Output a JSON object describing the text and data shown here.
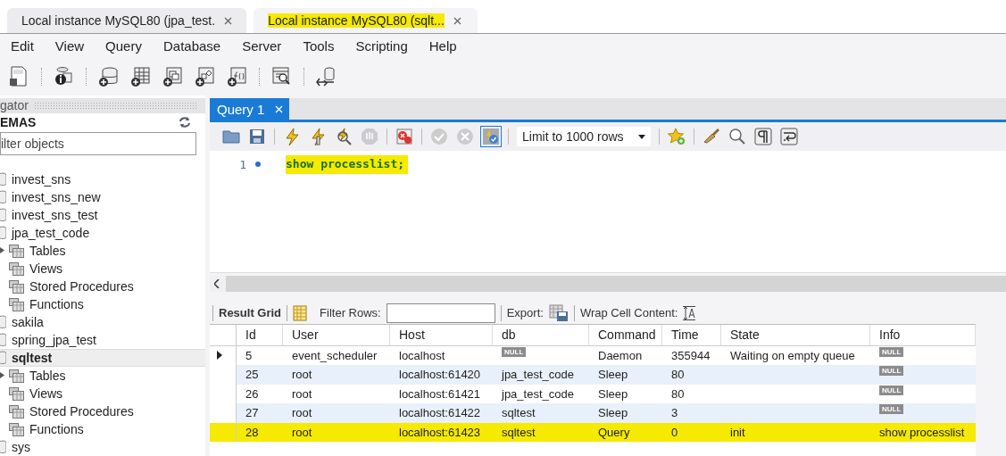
{
  "doc_tabs": [
    {
      "label": "Local instance MySQL80 (jpa_test.",
      "selected": false,
      "highlighted": false
    },
    {
      "label": "Local instance MySQL80 (sqlt...",
      "selected": true,
      "highlighted": true
    }
  ],
  "menu": [
    "Edit",
    "View",
    "Query",
    "Database",
    "Server",
    "Tools",
    "Scripting",
    "Help"
  ],
  "navigator": {
    "title": "gator",
    "schemas_label": "EMAS",
    "filter": {
      "placeholder": "ilter objects"
    },
    "schemas": [
      {
        "name": "invest_sns",
        "selected": false
      },
      {
        "name": "invest_sns_new",
        "selected": false
      },
      {
        "name": "invest_sns_test",
        "selected": false
      },
      {
        "name": "jpa_test_code",
        "selected": false,
        "children": [
          {
            "name": "Tables",
            "expander": true
          },
          {
            "name": "Views",
            "expander": false
          },
          {
            "name": "Stored Procedures",
            "expander": false
          },
          {
            "name": "Functions",
            "expander": false
          }
        ]
      },
      {
        "name": "sakila",
        "selected": false
      },
      {
        "name": "spring_jpa_test",
        "selected": false
      },
      {
        "name": "sqltest",
        "selected": true,
        "children": [
          {
            "name": "Tables",
            "expander": true
          },
          {
            "name": "Views",
            "expander": false
          },
          {
            "name": "Stored Procedures",
            "expander": false
          },
          {
            "name": "Functions",
            "expander": false
          }
        ]
      },
      {
        "name": "sys",
        "selected": false
      }
    ]
  },
  "query_tabs": [
    {
      "label": "Query 1",
      "selected": true
    }
  ],
  "editor_toolbar": {
    "limit": "Limit to 1000 rows",
    "autocommit_pressed": true
  },
  "editor": {
    "lines": [
      {
        "number": "1",
        "code": "show processlist;",
        "highlighted": true
      }
    ]
  },
  "results": {
    "tab": "Result Grid",
    "filter_label": "Filter Rows:",
    "export_label": "Export:",
    "wrap_label": "Wrap Cell Content:",
    "columns": [
      "Id",
      "User",
      "Host",
      "db",
      "Command",
      "Time",
      "State",
      "Info"
    ],
    "rows": [
      {
        "current": true,
        "highlighted": false,
        "cells": [
          {
            "kind": "value",
            "text": "5"
          },
          {
            "kind": "value",
            "text": "event_scheduler"
          },
          {
            "kind": "value",
            "text": "localhost"
          },
          {
            "kind": "null",
            "text": "NULL"
          },
          {
            "kind": "value",
            "text": "Daemon"
          },
          {
            "kind": "value",
            "text": "355944"
          },
          {
            "kind": "value",
            "text": "Waiting on empty queue"
          },
          {
            "kind": "null",
            "text": "NULL"
          }
        ]
      },
      {
        "current": false,
        "highlighted": false,
        "cells": [
          {
            "kind": "value",
            "text": "25"
          },
          {
            "kind": "value",
            "text": "root"
          },
          {
            "kind": "value",
            "text": "localhost:61420"
          },
          {
            "kind": "value",
            "text": "jpa_test_code"
          },
          {
            "kind": "value",
            "text": "Sleep"
          },
          {
            "kind": "value",
            "text": "80"
          },
          {
            "kind": "empty"
          },
          {
            "kind": "null",
            "text": "NULL"
          }
        ]
      },
      {
        "current": false,
        "highlighted": false,
        "cells": [
          {
            "kind": "value",
            "text": "26"
          },
          {
            "kind": "value",
            "text": "root"
          },
          {
            "kind": "value",
            "text": "localhost:61421"
          },
          {
            "kind": "value",
            "text": "jpa_test_code"
          },
          {
            "kind": "value",
            "text": "Sleep"
          },
          {
            "kind": "value",
            "text": "80"
          },
          {
            "kind": "empty"
          },
          {
            "kind": "null",
            "text": "NULL"
          }
        ]
      },
      {
        "current": false,
        "highlighted": false,
        "cells": [
          {
            "kind": "value",
            "text": "27"
          },
          {
            "kind": "value",
            "text": "root"
          },
          {
            "kind": "value",
            "text": "localhost:61422"
          },
          {
            "kind": "value",
            "text": "sqltest"
          },
          {
            "kind": "value",
            "text": "Sleep"
          },
          {
            "kind": "value",
            "text": "3"
          },
          {
            "kind": "empty"
          },
          {
            "kind": "null",
            "text": "NULL"
          }
        ]
      },
      {
        "current": false,
        "highlighted": true,
        "cells": [
          {
            "kind": "value",
            "text": "28"
          },
          {
            "kind": "value",
            "text": "root"
          },
          {
            "kind": "value",
            "text": "localhost:61423"
          },
          {
            "kind": "value",
            "text": "sqltest"
          },
          {
            "kind": "value",
            "text": "Query"
          },
          {
            "kind": "value",
            "text": "0"
          },
          {
            "kind": "value",
            "text": "init"
          },
          {
            "kind": "value",
            "text": "show processlist"
          }
        ]
      }
    ]
  }
}
